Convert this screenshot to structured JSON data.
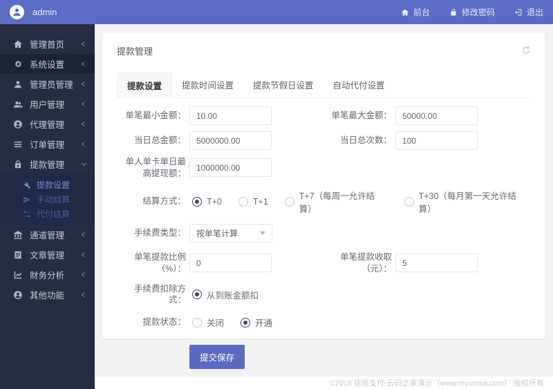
{
  "topbar": {
    "username": "admin",
    "avatar_icon": "user-avatar-icon",
    "nav": [
      {
        "label": "前台",
        "icon": "home-icon"
      },
      {
        "label": "修改密码",
        "icon": "lock-icon"
      },
      {
        "label": "退出",
        "icon": "logout-icon"
      }
    ]
  },
  "sidebar": {
    "items": [
      {
        "label": "管理首页",
        "icon": "home-icon",
        "state": "collapsed"
      },
      {
        "label": "系统设置",
        "icon": "gears-icon",
        "state": "collapsed"
      },
      {
        "label": "管理员管理",
        "icon": "admin-user-icon",
        "state": "collapsed"
      },
      {
        "label": "用户管理",
        "icon": "users-icon",
        "state": "collapsed"
      },
      {
        "label": "代理管理",
        "icon": "agent-icon",
        "state": "collapsed"
      },
      {
        "label": "订单管理",
        "icon": "orders-list-icon",
        "state": "collapsed"
      },
      {
        "label": "提款管理",
        "icon": "withdraw-lock-icon",
        "state": "expanded"
      },
      {
        "label": "通道管理",
        "icon": "bank-icon",
        "state": "collapsed"
      },
      {
        "label": "文章管理",
        "icon": "article-icon",
        "state": "collapsed"
      },
      {
        "label": "财务分析",
        "icon": "chart-icon",
        "state": "collapsed"
      },
      {
        "label": "其他功能",
        "icon": "other-user-icon",
        "state": "collapsed"
      }
    ],
    "submenu": [
      {
        "label": "提款设置",
        "icon": "wrench-icon",
        "active": true
      },
      {
        "label": "手动结算",
        "icon": "send-icon",
        "active": false
      },
      {
        "label": "代付结算",
        "icon": "exchange-icon",
        "active": false
      }
    ]
  },
  "main": {
    "card_title": "提款管理",
    "refresh_icon": "refresh-icon",
    "tabs": [
      {
        "label": "提款设置",
        "active": true
      },
      {
        "label": "提款时间设置",
        "active": false
      },
      {
        "label": "提款节假日设置",
        "active": false
      },
      {
        "label": "自动代付设置",
        "active": false
      }
    ],
    "form": {
      "min_amount": {
        "label": "单笔最小金额：",
        "value": "10.00"
      },
      "max_amount": {
        "label": "单笔最大金额：",
        "value": "50000.00"
      },
      "daily_total": {
        "label": "当日总金额：",
        "value": "5000000.00"
      },
      "daily_count": {
        "label": "当日总次数：",
        "value": "100"
      },
      "card_daily_max": {
        "label": "单人单卡单日最高提现额：",
        "value": "1000000.00"
      },
      "settlement": {
        "label": "结算方式：",
        "options": [
          {
            "label": "T+0",
            "checked": true
          },
          {
            "label": "T+1",
            "checked": false
          },
          {
            "label": "T+7（每周一允许结算）",
            "checked": false
          },
          {
            "label": "T+30（每月第一天允许结算）",
            "checked": false
          }
        ]
      },
      "fee_type": {
        "label": "手续费类型：",
        "value": "按单笔计算"
      },
      "fee_percent": {
        "label": "单笔提款比例（%）：",
        "value": "0"
      },
      "fee_fixed": {
        "label": "单笔提款收取（元）：",
        "value": "5"
      },
      "fee_deduct": {
        "label": "手续费扣除方式：",
        "options": [
          {
            "label": "从到账金额扣",
            "checked": true
          }
        ]
      },
      "status": {
        "label": "提款状态：",
        "options": [
          {
            "label": "关闭",
            "checked": false
          },
          {
            "label": "开通",
            "checked": true
          }
        ]
      },
      "submit_label": "提交保存"
    }
  },
  "footer": {
    "copyright": "©2018 信恒支付-云码之家演示（www.myunma.com） 版权所有"
  },
  "colors": {
    "topbar": "#5a6cc3",
    "sidebar": "#262d42",
    "submenu_bg": "#212946",
    "submenu_active_text": "#7d88d3",
    "accent_button": "#5a6bc0",
    "radio_checked": "#3f4867",
    "content_bg": "#f2f2f3"
  }
}
